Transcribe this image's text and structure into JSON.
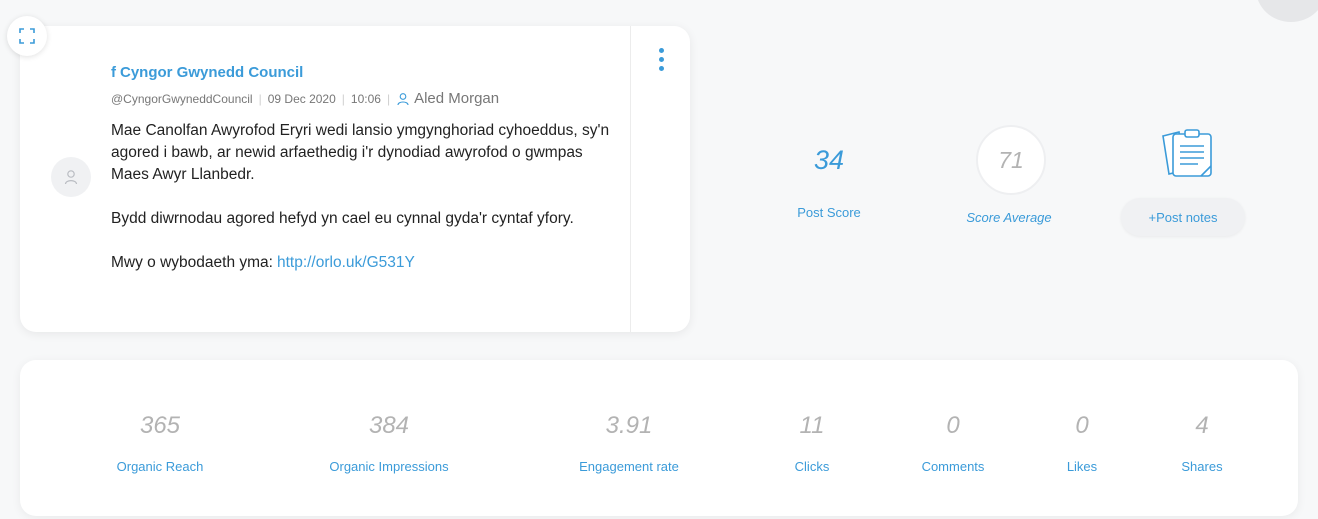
{
  "post": {
    "page_name": "Cyngor Gwynedd Council",
    "handle": "@CyngorGwyneddCouncil",
    "date": "09 Dec 2020",
    "time": "10:06",
    "author": "Aled Morgan",
    "paragraph1": "Mae Canolfan Awyrofod Eryri wedi lansio ymgynghoriad cyhoeddus, sy'n agored i bawb, ar newid arfaethedig i'r dynodiad awyrofod o gwmpas Maes Awyr Llanbedr.",
    "paragraph2": "Bydd diwrnodau agored hefyd yn cael eu cynnal gyda'r cyntaf yfory.",
    "more_info_label": "Mwy o wybodaeth yma:",
    "link": "http://orlo.uk/G531Y"
  },
  "scores": {
    "post_score_value": "34",
    "post_score_label": "Post Score",
    "score_average_value": "71",
    "score_average_label": "Score Average",
    "post_notes_button": "+Post notes"
  },
  "stats": [
    {
      "value": "365",
      "label": "Organic Reach"
    },
    {
      "value": "384",
      "label": "Organic Impressions"
    },
    {
      "value": "3.91",
      "label": "Engagement rate"
    },
    {
      "value": "11",
      "label": "Clicks"
    },
    {
      "value": "0",
      "label": "Comments"
    },
    {
      "value": "0",
      "label": "Likes"
    },
    {
      "value": "4",
      "label": "Shares"
    }
  ],
  "icons": {
    "expand": "expand-icon",
    "facebook": "facebook-icon",
    "user": "user-icon",
    "kebab": "kebab-menu-icon",
    "notes": "notes-clipboard-icon"
  },
  "colors": {
    "accent": "#3b9bd9",
    "muted_value": "#b3b3b3",
    "background": "#f7f8f9"
  }
}
